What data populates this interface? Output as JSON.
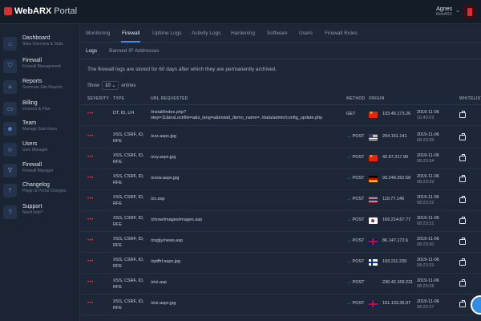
{
  "app": {
    "title_brand": "WebARX",
    "title_rest": " Portal"
  },
  "user": {
    "name": "Agnes",
    "org": "WebARX"
  },
  "sidebar": {
    "items": [
      {
        "title": "Dashboard",
        "sub": "Sites Overview & Stats",
        "icon": "home-icon"
      },
      {
        "title": "Firewall",
        "sub": "Firewall Management",
        "icon": "shield-icon"
      },
      {
        "title": "Reports",
        "sub": "Generate Site Reports",
        "icon": "report-icon"
      },
      {
        "title": "Billing",
        "sub": "Invoices & Plan",
        "icon": "card-icon"
      },
      {
        "title": "Team",
        "sub": "Manage Sub-Users",
        "icon": "team-icon"
      },
      {
        "title": "Users",
        "sub": "User Manager",
        "icon": "user-icon"
      },
      {
        "title": "Firewall",
        "sub": "Firewall Manager",
        "icon": "filter-icon"
      },
      {
        "title": "Changelog",
        "sub": "Plugin & Portal Changes",
        "icon": "changelog-icon"
      },
      {
        "title": "Support",
        "sub": "Need help?",
        "icon": "help-icon"
      }
    ]
  },
  "tabs": [
    "Monitoring",
    "Firewall",
    "Uptime Logs",
    "Activity Logs",
    "Hardening",
    "Software",
    "Users",
    "Firewall Rules"
  ],
  "subtabs": [
    "Logs",
    "Banned IP Addresses"
  ],
  "notice": "The firewall logs are stored for 60 days after which they are permanently archived.",
  "show": {
    "prefix": "Show",
    "value": "10",
    "suffix": "entries"
  },
  "table": {
    "headers": [
      "SEVERITY",
      "TYPE",
      "URL REQUESTED",
      "METHOD",
      "ORIGIN",
      "WHITELIST"
    ],
    "rows": [
      {
        "sev": "•••",
        "type": "DT, ID, LFI",
        "url": "/install/index.php?step=11&insLockfile=a&s_lang=a&install_demo_name=../data/admin/config_update.php",
        "method": "GET",
        "arrow": "",
        "flag": "cn",
        "ip": "103.45.173.26",
        "date": "2019-11-06",
        "time": "10:40:03"
      },
      {
        "sev": "•••",
        "type": "XSS, CSRF, ID, RFE",
        "url": "/zzz.aspx.jpg",
        "method": "POST",
        "arrow": "→",
        "flag": "us",
        "ip": "204.161.141",
        "date": "2019-11-06",
        "time": "08:23:35"
      },
      {
        "sev": "•••",
        "type": "XSS, CSRF, ID, RFE",
        "url": "/zzy.aspx.jpg",
        "method": "POST",
        "arrow": "→",
        "flag": "cn",
        "ip": "42.97.217.90",
        "date": "2019-11-06",
        "time": "08:23:34"
      },
      {
        "sev": "•••",
        "type": "XSS, CSRF, ID, RFE",
        "url": "/zxxw.aspx.jpg",
        "method": "POST",
        "arrow": "→",
        "flag": "de",
        "ip": "93.249.252.58",
        "date": "2019-11-06",
        "time": "08:23:33"
      },
      {
        "sev": "•••",
        "type": "XSS, CSRF, ID, RFE",
        "url": "/zx.asp",
        "method": "POST",
        "arrow": "→",
        "flag": "th",
        "ip": "119.77.140",
        "date": "2019-11-06",
        "time": "08:23:32"
      },
      {
        "sev": "•••",
        "type": "XSS, CSRF, ID, RFE",
        "url": "/ztxxw/images/images.asp",
        "method": "POST",
        "arrow": "→",
        "flag": "kr",
        "ip": "169.214.67.77",
        "date": "2019-11-06",
        "time": "08:23:31"
      },
      {
        "sev": "•••",
        "type": "XSS, CSRF, ID, RFE",
        "url": "/zsgljy/news.asp",
        "method": "POST",
        "arrow": "→",
        "flag": "gb",
        "ip": "86.147.172.6",
        "date": "2019-11-06",
        "time": "08:23:30"
      },
      {
        "sev": "•••",
        "type": "XSS, CSRF, ID, RFE",
        "url": "/zptfhf.aspx.jpg",
        "method": "POST",
        "arrow": "→",
        "flag": "fi",
        "ip": "193.211.239",
        "date": "2019-11-06",
        "time": "08:23:29"
      },
      {
        "sev": "•••",
        "type": "XSS, CSRF, ID, RFE",
        "url": "/zixi.asp",
        "method": "POST",
        "arrow": "→",
        "flag": "none",
        "ip": "236.42.169.231",
        "date": "2019-11-06",
        "time": "08:23:28"
      },
      {
        "sev": "•••",
        "type": "XSS, CSRF, ID, RFE",
        "url": "/zixi.aspx.jpg",
        "method": "POST",
        "arrow": "→",
        "flag": "gb",
        "ip": "151.133.35.97",
        "date": "2019-11-06",
        "time": "08:22:27"
      }
    ]
  },
  "colors": {
    "accent": "#3d8ef0",
    "brand": "#d53133",
    "severity": "#d9463e"
  }
}
